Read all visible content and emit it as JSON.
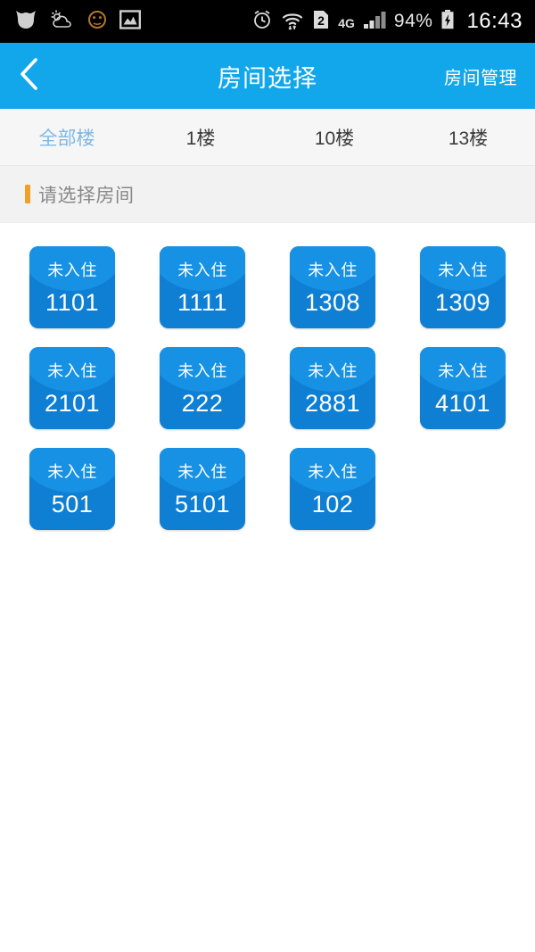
{
  "statusbar": {
    "left_icons": [
      "owl-app-icon",
      "weather-cloud-sun-icon",
      "emoji-face-icon",
      "gallery-photo-icon"
    ],
    "right_icons": [
      "alarm-clock-icon",
      "wifi-icon",
      "sim-2-icon",
      "signal-bars-icon",
      "battery-charging-icon"
    ],
    "network": "4G",
    "sim_label": "2",
    "battery_percent": "94%",
    "clock": "16:43"
  },
  "appbar": {
    "back_icon": "chevron-left-icon",
    "title": "房间选择",
    "action_label": "房间管理",
    "bg_color": "#12a6eb"
  },
  "tabs": {
    "active_index": 0,
    "active_color": "#7fb8e6",
    "items": [
      {
        "label": "全部楼"
      },
      {
        "label": "1楼"
      },
      {
        "label": "10楼"
      },
      {
        "label": "13楼"
      }
    ]
  },
  "section": {
    "title": "请选择房间",
    "accent_color": "#f0a028"
  },
  "rooms": [
    {
      "status": "未入住",
      "number": "1101"
    },
    {
      "status": "未入住",
      "number": "1111"
    },
    {
      "status": "未入住",
      "number": "1308"
    },
    {
      "status": "未入住",
      "number": "1309"
    },
    {
      "status": "未入住",
      "number": "2101"
    },
    {
      "status": "未入住",
      "number": "222"
    },
    {
      "status": "未入住",
      "number": "2881"
    },
    {
      "status": "未入住",
      "number": "4101"
    },
    {
      "status": "未入住",
      "number": "501"
    },
    {
      "status": "未入住",
      "number": "5101"
    },
    {
      "status": "未入住",
      "number": "102"
    }
  ],
  "room_card_color": "#0f7fd4"
}
